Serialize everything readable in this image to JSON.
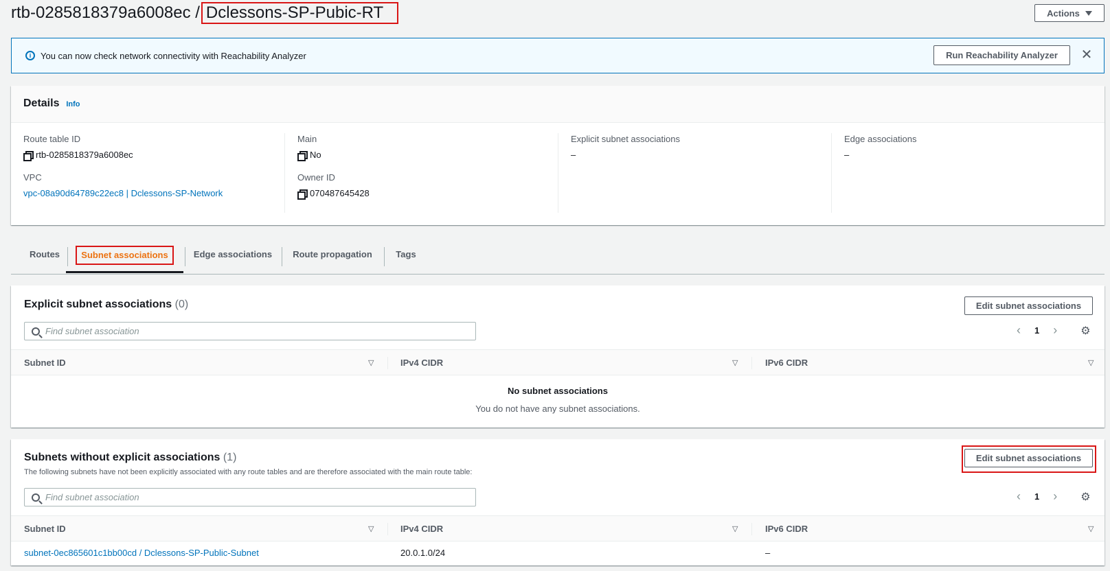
{
  "header": {
    "title_prefix": "rtb-0285818379a6008ec /",
    "title_name": "Dclessons-SP-Pubic-RT",
    "actions_label": "Actions"
  },
  "flash": {
    "message": "You can now check network connectivity with Reachability Analyzer",
    "button_label": "Run Reachability Analyzer"
  },
  "details": {
    "title": "Details",
    "info_link": "Info",
    "route_table_id_label": "Route table ID",
    "route_table_id": "rtb-0285818379a6008ec",
    "vpc_label": "VPC",
    "vpc_value": "vpc-08a90d64789c22ec8 | Dclessons-SP-Network",
    "main_label": "Main",
    "main_value": "No",
    "owner_label": "Owner ID",
    "owner_value": "070487645428",
    "explicit_label": "Explicit subnet associations",
    "explicit_value": "–",
    "edge_label": "Edge associations",
    "edge_value": "–"
  },
  "tabs": [
    {
      "label": "Routes"
    },
    {
      "label": "Subnet associations"
    },
    {
      "label": "Edge associations"
    },
    {
      "label": "Route propagation"
    },
    {
      "label": "Tags"
    }
  ],
  "explicit_panel": {
    "title": "Explicit subnet associations",
    "count": "(0)",
    "edit_label": "Edit subnet associations",
    "search_placeholder": "Find subnet association",
    "page": "1",
    "columns": [
      "Subnet ID",
      "IPv4 CIDR",
      "IPv6 CIDR"
    ],
    "empty_title": "No subnet associations",
    "empty_desc": "You do not have any subnet associations."
  },
  "implicit_panel": {
    "title": "Subnets without explicit associations",
    "count": "(1)",
    "description": "The following subnets have not been explicitly associated with any route tables and are therefore associated with the main route table:",
    "edit_label": "Edit subnet associations",
    "search_placeholder": "Find subnet association",
    "page": "1",
    "columns": [
      "Subnet ID",
      "IPv4 CIDR",
      "IPv6 CIDR"
    ],
    "rows": [
      {
        "subnet_id": "subnet-0ec865601c1bb00cd / Dclessons-SP-Public-Subnet",
        "ipv4": "20.0.1.0/24",
        "ipv6": "–"
      }
    ]
  },
  "colors": {
    "link": "#0073bb",
    "active_tab": "#ec7211",
    "highlight_box": "#d91515"
  }
}
